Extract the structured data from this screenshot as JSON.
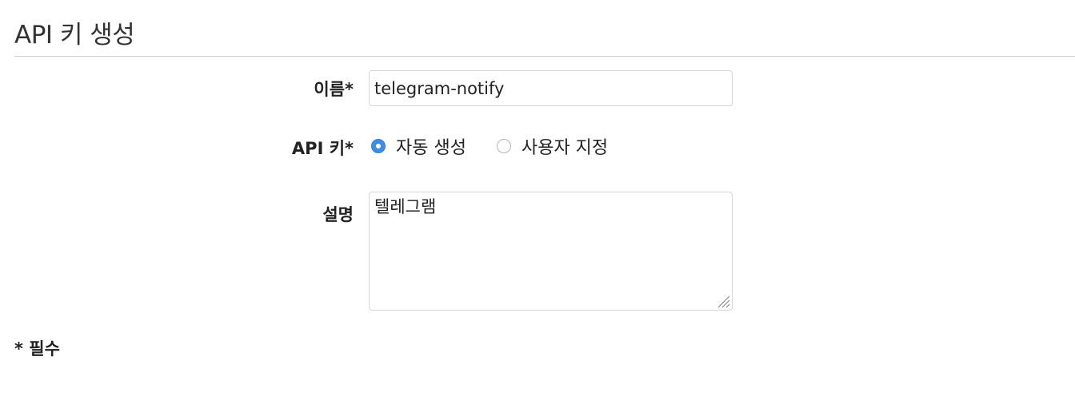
{
  "page": {
    "title": "API 키 생성"
  },
  "form": {
    "name": {
      "label": "이름*",
      "value": "telegram-notify"
    },
    "api_key": {
      "label": "API 키*",
      "options": [
        {
          "label": "자동 생성",
          "selected": true
        },
        {
          "label": "사용자 지정",
          "selected": false
        }
      ]
    },
    "description": {
      "label": "설명",
      "value": "텔레그램"
    }
  },
  "footer": {
    "required_note": "* 필수"
  },
  "colors": {
    "accent": "#3d8ee8",
    "border": "#d6d6d6",
    "divider": "#cfcfcf"
  }
}
